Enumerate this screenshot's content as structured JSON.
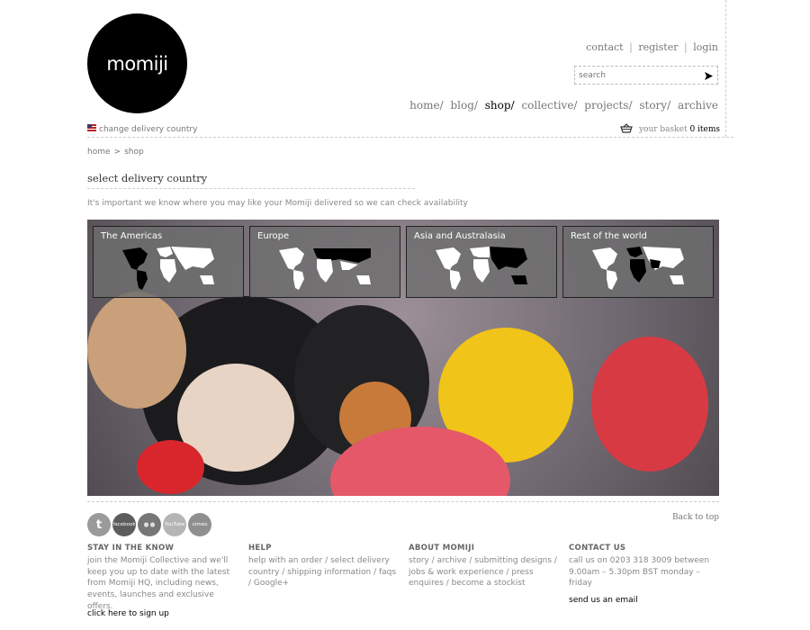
{
  "brand": {
    "logo_text": "momiji"
  },
  "top_links": {
    "contact": "contact",
    "register": "register",
    "login": "login",
    "sep": "|"
  },
  "search": {
    "placeholder": "search"
  },
  "nav": [
    {
      "label": "home/",
      "active": false
    },
    {
      "label": "blog/",
      "active": false
    },
    {
      "label": "shop/",
      "active": true
    },
    {
      "label": "collective/",
      "active": false
    },
    {
      "label": "projects/",
      "active": false
    },
    {
      "label": "story/",
      "active": false
    },
    {
      "label": "archive",
      "active": false
    }
  ],
  "delivery": {
    "change_label": "change delivery country"
  },
  "basket": {
    "label": "your basket",
    "count": "0 items"
  },
  "breadcrumb": {
    "home": "home",
    "sep": ">",
    "current": "shop"
  },
  "page": {
    "title": "select delivery country",
    "intro": "It's important we know where you may like your Momiji delivered so we can check availability"
  },
  "regions": [
    {
      "label": "The Americas"
    },
    {
      "label": "Europe"
    },
    {
      "label": "Asia and Australasia"
    },
    {
      "label": "Rest of the world"
    }
  ],
  "socials": [
    "t",
    "facebook",
    "flickr",
    "YouTube",
    "vimeo"
  ],
  "footer": {
    "back_to_top": "Back to top",
    "stay": {
      "heading": "STAY IN THE KNOW",
      "text": "join the Momiji Collective and we'll keep you up to date with the latest from Momiji HQ, including news, events, launches and exclusive offers.",
      "signup": "click here to sign up"
    },
    "help": {
      "heading": "HELP",
      "text": "help with an order / select delivery country / shipping information / faqs / Google+"
    },
    "about": {
      "heading": "ABOUT MOMIJI",
      "text": "story / archive / submitting designs / jobs & work experience / press enquires / become a stockist"
    },
    "contact": {
      "heading": "CONTACT US",
      "text": "call us on 0203 318 3009 between 9.00am – 5.30pm BST monday – friday",
      "email": "send us an email"
    }
  }
}
